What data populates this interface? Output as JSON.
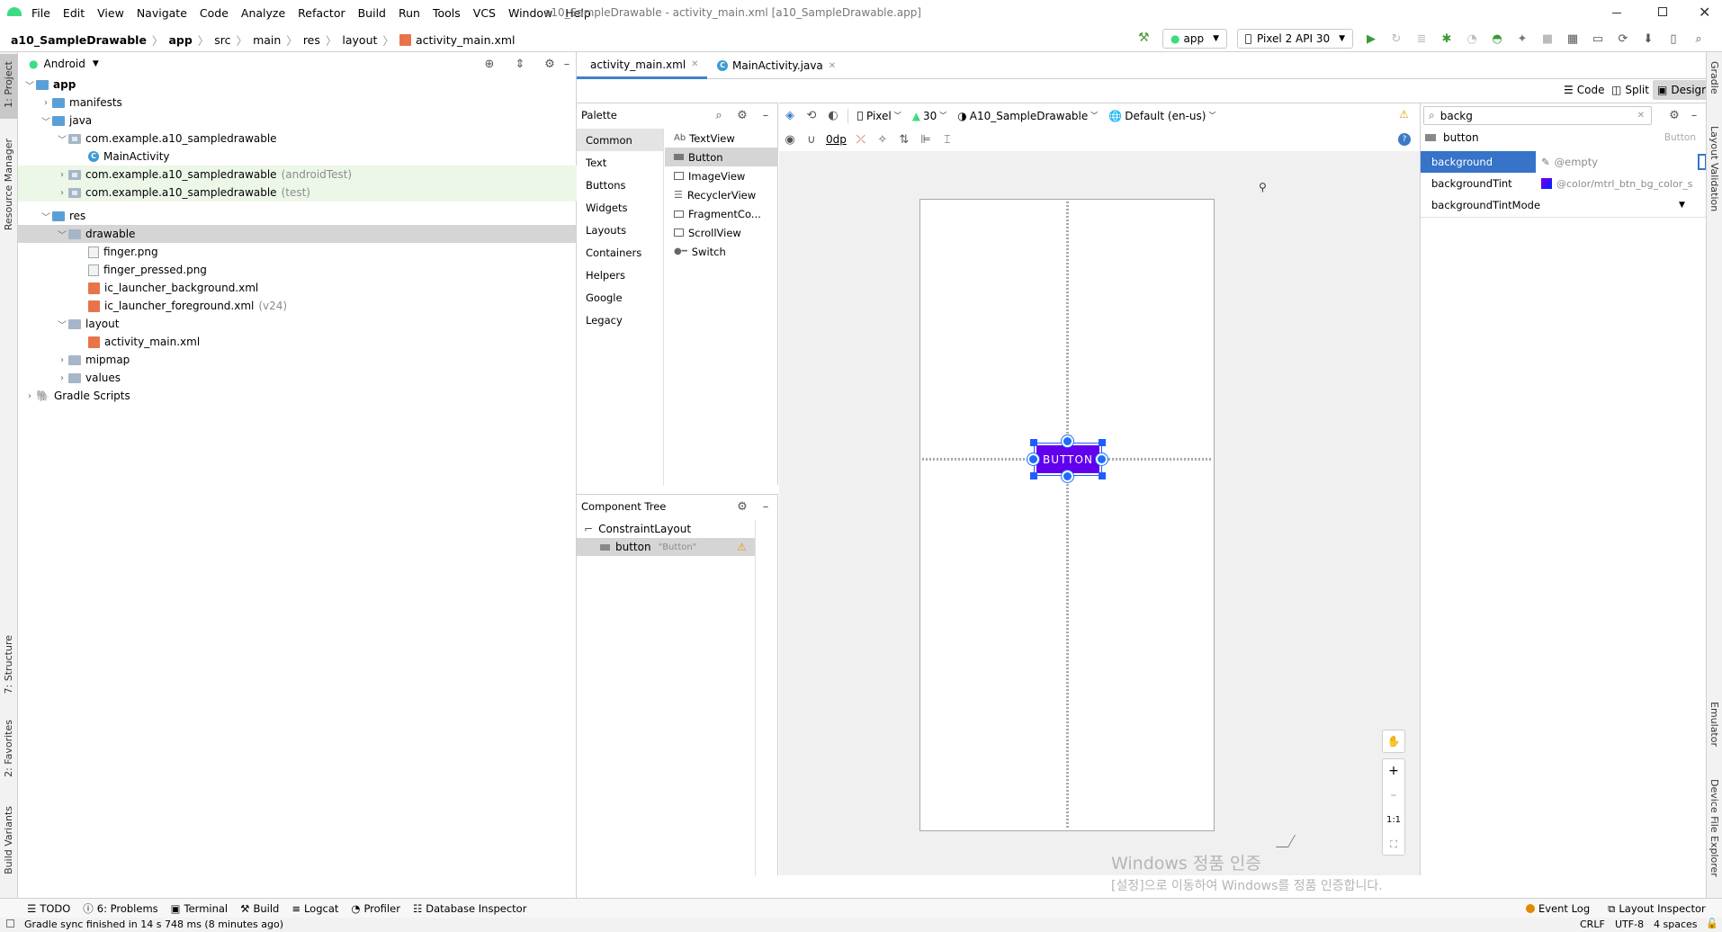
{
  "window": {
    "title": "a10_SampleDrawable - activity_main.xml [a10_SampleDrawable.app]",
    "menu": [
      "File",
      "Edit",
      "View",
      "Navigate",
      "Code",
      "Analyze",
      "Refactor",
      "Build",
      "Run",
      "Tools",
      "VCS",
      "Window",
      "Help"
    ]
  },
  "breadcrumb": [
    "a10_SampleDrawable",
    "app",
    "src",
    "main",
    "res",
    "layout",
    "activity_main.xml"
  ],
  "run_config": {
    "module": "app",
    "device": "Pixel 2 API 30"
  },
  "left_strip": {
    "project": "1: Project",
    "resource_manager": "Resource Manager",
    "structure": "7: Structure",
    "favorites": "2: Favorites",
    "build_variants": "Build Variants"
  },
  "right_strip": {
    "gradle": "Gradle",
    "layout_validation": "Layout Validation",
    "emulator": "Emulator",
    "device_file_explorer": "Device File Explorer"
  },
  "project_panel": {
    "view_selector": "Android",
    "tree": [
      {
        "label": "app",
        "suffix": "",
        "indent": 0,
        "icon": "folder-icon"
      },
      {
        "label": "manifests",
        "suffix": "",
        "indent": 1,
        "icon": "folder-icon"
      },
      {
        "label": "java",
        "suffix": "",
        "indent": 1,
        "icon": "folder-icon"
      },
      {
        "label": "com.example.a10_sampledrawable",
        "suffix": "",
        "indent": 2,
        "icon": "package-icon"
      },
      {
        "label": "MainActivity",
        "suffix": "",
        "indent": 3,
        "icon": "class-icon"
      },
      {
        "label": "com.example.a10_sampledrawable",
        "suffix": "(androidTest)",
        "indent": 2,
        "icon": "package-icon"
      },
      {
        "label": "com.example.a10_sampledrawable",
        "suffix": "(test)",
        "indent": 2,
        "icon": "package-icon"
      },
      {
        "label": "res",
        "suffix": "",
        "indent": 1,
        "icon": "folder-icon"
      },
      {
        "label": "drawable",
        "suffix": "",
        "indent": 2,
        "icon": "folder-icon"
      },
      {
        "label": "finger.png",
        "suffix": "",
        "indent": 3,
        "icon": "image-file-icon"
      },
      {
        "label": "finger_pressed.png",
        "suffix": "",
        "indent": 3,
        "icon": "image-file-icon"
      },
      {
        "label": "ic_launcher_background.xml",
        "suffix": "",
        "indent": 3,
        "icon": "xml-file-icon"
      },
      {
        "label": "ic_launcher_foreground.xml",
        "suffix": "(v24)",
        "indent": 3,
        "icon": "xml-file-icon"
      },
      {
        "label": "layout",
        "suffix": "",
        "indent": 2,
        "icon": "folder-icon"
      },
      {
        "label": "activity_main.xml",
        "suffix": "",
        "indent": 3,
        "icon": "xml-file-icon"
      },
      {
        "label": "mipmap",
        "suffix": "",
        "indent": 2,
        "icon": "folder-icon"
      },
      {
        "label": "values",
        "suffix": "",
        "indent": 2,
        "icon": "folder-icon"
      },
      {
        "label": "Gradle Scripts",
        "suffix": "",
        "indent": 0,
        "icon": "gradle-icon"
      }
    ]
  },
  "editor_tabs": [
    "activity_main.xml",
    "MainActivity.java"
  ],
  "view_modes": {
    "code": "Code",
    "split": "Split",
    "design": "Design"
  },
  "palette": {
    "title": "Palette",
    "categories": [
      "Common",
      "Text",
      "Buttons",
      "Widgets",
      "Layouts",
      "Containers",
      "Helpers",
      "Google",
      "Legacy"
    ],
    "items": [
      {
        "prefix": "Ab",
        "label": "TextView"
      },
      {
        "prefix": "",
        "label": "Button"
      },
      {
        "prefix": "",
        "label": "ImageView"
      },
      {
        "prefix": "",
        "label": "RecyclerView"
      },
      {
        "prefix": "",
        "label": "FragmentCo..."
      },
      {
        "prefix": "",
        "label": "ScrollView"
      },
      {
        "prefix": "",
        "label": "Switch"
      }
    ]
  },
  "design_toolbar": {
    "device": "Pixel",
    "api": "30",
    "theme": "A10_SampleDrawable",
    "locale": "Default (en-us)",
    "margin": "0dp"
  },
  "component_tree": {
    "title": "Component Tree",
    "root": "ConstraintLayout",
    "child": "button",
    "child_text": "\"Button\""
  },
  "canvas": {
    "button_text": "BUTTON",
    "button_color": "#6200ee",
    "zoom_reset": "1:1"
  },
  "attributes": {
    "search": "backg",
    "component": "button",
    "component_type": "Button",
    "rows": [
      {
        "name": "background",
        "value": "@empty"
      },
      {
        "name": "backgroundTint",
        "value": "@color/mtrl_btn_bg_color_s"
      },
      {
        "name": "backgroundTintMode",
        "value": ""
      }
    ]
  },
  "watermark": {
    "line1": "Windows 정품 인증",
    "line2": "[설정]으로 이동하여 Windows를 정품 인증합니다."
  },
  "bottom_tools": [
    "TODO",
    "6: Problems",
    "Terminal",
    "Build",
    "Logcat",
    "Profiler",
    "Database Inspector"
  ],
  "bottom_tools_right": [
    "Event Log",
    "Layout Inspector"
  ],
  "status": {
    "message": "Gradle sync finished in 14 s 748 ms (8 minutes ago)",
    "line_sep": "CRLF",
    "encoding": "UTF-8",
    "indent": "4 spaces"
  }
}
